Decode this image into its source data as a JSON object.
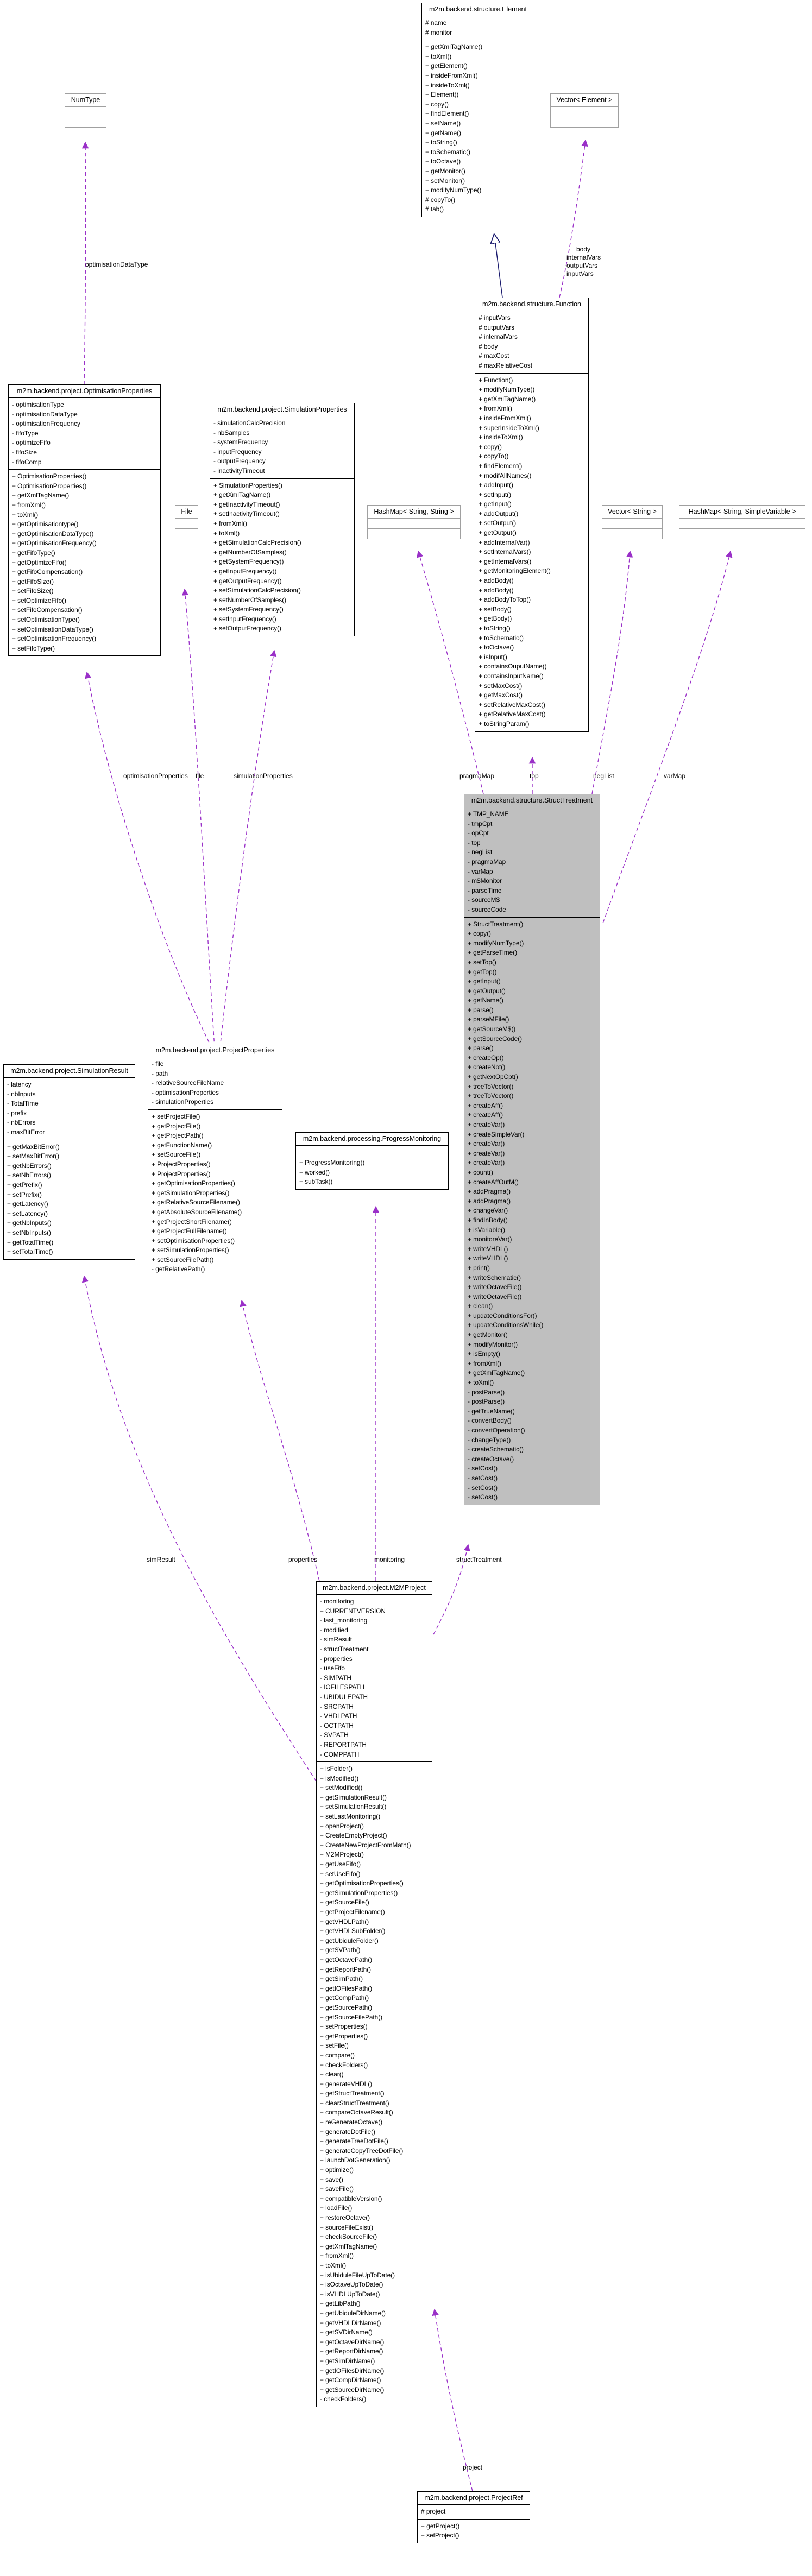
{
  "classes": {
    "element": {
      "name": "m2m.backend.structure.Element",
      "attributes": [
        "# name",
        "# monitor"
      ],
      "operations": [
        "+ getXmlTagName()",
        "+ toXml()",
        "+ getElement()",
        "+ insideFromXml()",
        "+ insideToXml()",
        "+ Element()",
        "+ copy()",
        "+ findElement()",
        "+ setName()",
        "+ getName()",
        "+ toString()",
        "+ toSchematic()",
        "+ toOctave()",
        "+ getMonitor()",
        "+ setMonitor()",
        "+ modifyNumType()",
        "# copyTo()",
        "# tab()"
      ]
    },
    "numtype": {
      "name": "NumType",
      "attributes": [],
      "operations": []
    },
    "vector_element": {
      "name": "Vector< Element >",
      "attributes": [],
      "operations": []
    },
    "function": {
      "name": "m2m.backend.structure.Function",
      "attributes": [
        "# inputVars",
        "# outputVars",
        "# internalVars",
        "# body",
        "# maxCost",
        "# maxRelativeCost"
      ],
      "operations": [
        "+ Function()",
        "+ modifyNumType()",
        "+ getXmlTagName()",
        "+ fromXml()",
        "+ insideFromXml()",
        "+ superInsideToXml()",
        "+ insideToXml()",
        "+ copy()",
        "+ copyTo()",
        "+ findElement()",
        "+ modifAllNames()",
        "+ addInput()",
        "+ setInput()",
        "+ getInput()",
        "+ addOutput()",
        "+ setOutput()",
        "+ getOutput()",
        "+ addInternalVar()",
        "+ setInternalVars()",
        "+ getInternalVars()",
        "+ getMonitoringElement()",
        "+ addBody()",
        "+ addBody()",
        "+ addBodyToTop()",
        "+ setBody()",
        "+ getBody()",
        "+ toString()",
        "+ toSchematic()",
        "+ toOctave()",
        "+ isInput()",
        "+ containsOuputName()",
        "+ containsInputName()",
        "+ setMaxCost()",
        "+ getMaxCost()",
        "+ setRelativeMaxCost()",
        "+ getRelativeMaxCost()",
        "+ toStringParam()"
      ]
    },
    "optimisation": {
      "name": "m2m.backend.project.OptimisationProperties",
      "attributes": [
        "- optimisationType",
        "- optimisationDataType",
        "- optimisationFrequency",
        "- fifoType",
        "- optimizeFifo",
        "- fifoSize",
        "- fifoComp"
      ],
      "operations": [
        "+ OptimisationProperties()",
        "+ OptimisationProperties()",
        "+ getXmlTagName()",
        "+ fromXml()",
        "+ toXml()",
        "+ getOptimisationtype()",
        "+ getOptimisationDataType()",
        "+ getOptimisationFrequency()",
        "+ getFifoType()",
        "+ getOptimizeFifo()",
        "+ getFifoCompensation()",
        "+ getFifoSize()",
        "+ setFifoSize()",
        "+ setOptimizeFifo()",
        "+ setFifoCompensation()",
        "+ setOptimisationType()",
        "+ setOptimisationDataType()",
        "+ setOptimisationFrequency()",
        "+ setFifoType()"
      ]
    },
    "simulation": {
      "name": "m2m.backend.project.SimulationProperties",
      "attributes": [
        "- simulationCalcPrecision",
        "- nbSamples",
        "- systemFrequency",
        "- inputFrequency",
        "- outputFrequency",
        "- inactivityTimeout"
      ],
      "operations": [
        "+ SimulationProperties()",
        "+ getXmlTagName()",
        "+ getInactivityTimeout()",
        "+ setInactivityTimeout()",
        "+ fromXml()",
        "+ toXml()",
        "+ getSimulationCalcPrecision()",
        "+ getNumberOfSamples()",
        "+ getSystemFrequency()",
        "+ getInputFrequency()",
        "+ getOutputFrequency()",
        "+ setSimulationCalcPrecision()",
        "+ setNumberOfSamples()",
        "+ setSystemFrequency()",
        "+ setInputFrequency()",
        "+ setOutputFrequency()"
      ]
    },
    "file": {
      "name": "File",
      "attributes": [],
      "operations": []
    },
    "hashmap_string": {
      "name": "HashMap< String, String >",
      "attributes": [],
      "operations": []
    },
    "vector_string": {
      "name": "Vector< String >",
      "attributes": [],
      "operations": []
    },
    "hashmap_var": {
      "name": "HashMap< String, SimpleVariable >",
      "attributes": [],
      "operations": []
    },
    "struct": {
      "name": "m2m.backend.structure.StructTreatment",
      "attributes": [
        "+ TMP_NAME",
        "- tmpCpt",
        "- opCpt",
        "- top",
        "- negList",
        "- pragmaMap",
        "- varMap",
        "- m$Monitor",
        "- parseTime",
        "- sourceM$",
        "- sourceCode"
      ],
      "operations": [
        "+ StructTreatment()",
        "+ copy()",
        "+ modifyNumType()",
        "+ getParseTime()",
        "+ setTop()",
        "+ getTop()",
        "+ getInput()",
        "+ getOutput()",
        "+ getName()",
        "+ parse()",
        "+ parseMFile()",
        "+ getSourceM$()",
        "+ getSourceCode()",
        "+ parse()",
        "+ createOp()",
        "+ createNot()",
        "+ getNextOpCpt()",
        "+ treeToVector()",
        "+ treeToVector()",
        "+ createAff()",
        "+ createAff()",
        "+ createVar()",
        "+ createSimpleVar()",
        "+ createVar()",
        "+ createVar()",
        "+ createVar()",
        "+ count()",
        "+ createAffOutM()",
        "+ addPragma()",
        "+ addPragma()",
        "+ changeVar()",
        "+ findInBody()",
        "+ isVariable()",
        "+ monitoreVar()",
        "+ writeVHDL()",
        "+ writeVHDL()",
        "+ print()",
        "+ writeSchematic()",
        "+ writeOctaveFile()",
        "+ writeOctaveFile()",
        "+ clean()",
        "+ updateConditionsFor()",
        "+ updateConditionsWhile()",
        "+ getMonitor()",
        "+ modifyMonitor()",
        "+ isEmpty()",
        "+ fromXml()",
        "+ getXmlTagName()",
        "+ toXml()",
        "- postParse()",
        "- postParse()",
        "- getTrueName()",
        "- convertBody()",
        "- convertOperation()",
        "- changeType()",
        "- createSchematic()",
        "- createOctave()",
        "- setCost()",
        "- setCost()",
        "- setCost()",
        "- setCost()"
      ]
    },
    "simresult": {
      "name": "m2m.backend.project.SimulationResult",
      "attributes": [
        "- latency",
        "- nbInputs",
        "- TotalTime",
        "- prefix",
        "- nbErrors",
        "- maxBitError"
      ],
      "operations": [
        "+ getMaxBitError()",
        "+ setMaxBitError()",
        "+ getNbErrors()",
        "+ setNbErrors()",
        "+ getPrefix()",
        "+ setPrefix()",
        "+ getLatency()",
        "+ setLatency()",
        "+ getNbInputs()",
        "+ setNbInputs()",
        "+ getTotalTime()",
        "+ setTotalTime()"
      ]
    },
    "projprops": {
      "name": "m2m.backend.project.ProjectProperties",
      "attributes": [
        "- file",
        "- path",
        "- relativeSourceFileName",
        "- optimisationProperties",
        "- simulationProperties"
      ],
      "operations": [
        "+ setProjectFile()",
        "+ getProjectFile()",
        "+ getProjectPath()",
        "+ getFunctionName()",
        "+ setSourceFile()",
        "+ ProjectProperties()",
        "+ ProjectProperties()",
        "+ getOptimisationProperties()",
        "+ getSimulationProperties()",
        "+ getRelativeSourceFilename()",
        "+ getAbsoluteSourceFilename()",
        "+ getProjectShortFilename()",
        "+ getProjectFullFilename()",
        "+ setOptimisationProperties()",
        "+ setSimulationProperties()",
        "+ setSourceFilePath()",
        "- getRelativePath()"
      ]
    },
    "monitoring": {
      "name": "m2m.backend.processing.ProgressMonitoring",
      "attributes": [],
      "operations": [
        "+ ProgressMonitoring()",
        "+ worked()",
        "+ subTask()"
      ]
    },
    "m2m": {
      "name": "m2m.backend.project.M2MProject",
      "attributes": [
        "- monitoring",
        "+ CURRENTVERSION",
        "- last_monitoring",
        "- modified",
        "- simResult",
        "- structTreatment",
        "- properties",
        "- useFifo",
        "- SIMPATH",
        "- IOFILESPATH",
        "- UBIDULEPATH",
        "- SRCPATH",
        "- VHDLPATH",
        "- OCTPATH",
        "- SVPATH",
        "- REPORTPATH",
        "- COMPPATH"
      ],
      "operations": [
        "+ isFolder()",
        "+ isModified()",
        "+ setModified()",
        "+ getSimulationResult()",
        "+ setSimulationResult()",
        "+ setLastMonitoring()",
        "+ openProject()",
        "+ CreateEmptyProject()",
        "+ CreateNewProjectFromMath()",
        "+ M2MProject()",
        "+ getUseFifo()",
        "+ setUseFifo()",
        "+ getOptimisationProperties()",
        "+ getSimulationProperties()",
        "+ getSourceFile()",
        "+ getProjectFilename()",
        "+ getVHDLPath()",
        "+ getVHDLSubFolder()",
        "+ getUbiduleFolder()",
        "+ getSVPath()",
        "+ getOctavePath()",
        "+ getReportPath()",
        "+ getSimPath()",
        "+ getIOFilesPath()",
        "+ getCompPath()",
        "+ getSourcePath()",
        "+ getSourceFilePath()",
        "+ setProperties()",
        "+ getProperties()",
        "+ setFile()",
        "+ compare()",
        "+ checkFolders()",
        "+ clear()",
        "+ generateVHDL()",
        "+ getStructTreatment()",
        "+ clearStructTreatment()",
        "+ compareOctaveResult()",
        "+ reGenerateOctave()",
        "+ generateDotFile()",
        "+ generateTreeDotFile()",
        "+ generateCopyTreeDotFile()",
        "+ launchDotGeneration()",
        "+ optimize()",
        "+ save()",
        "+ saveFile()",
        "+ compatibleVersion()",
        "+ loadFile()",
        "+ restoreOctave()",
        "+ sourceFileExist()",
        "+ checkSourceFile()",
        "+ getXmlTagName()",
        "+ fromXml()",
        "+ toXml()",
        "+ isUbiduleFileUpToDate()",
        "+ isOctaveUpToDate()",
        "+ isVHDLUpToDate()",
        "+ getLibPath()",
        "+ getUbiduleDirName()",
        "+ getVHDLDirName()",
        "+ getSVDirName()",
        "+ getOctaveDirName()",
        "+ getReportDirName()",
        "+ getSimDirName()",
        "+ getIOFilesDirName()",
        "+ getCompDirName()",
        "+ getSourceDirName()",
        "- checkFolders()"
      ]
    },
    "projref": {
      "name": "m2m.backend.project.ProjectRef",
      "attributes": [
        "# project"
      ],
      "operations": [
        "+ getProject()",
        "+ setProject()"
      ]
    }
  },
  "edge_labels": {
    "optimisationDataType": "optimisationDataType",
    "function_vars": [
      "body",
      "internalVars",
      "outputVars",
      "inputVars"
    ],
    "pragmaMap": "pragmaMap",
    "top": "top",
    "negList": "negList",
    "varMap": "varMap",
    "optimisationProperties": "optimisationProperties",
    "file": "file",
    "simulationProperties": "simulationProperties",
    "simResult": "simResult",
    "properties": "properties",
    "monitoring": "monitoring",
    "structTreatment": "structTreatment",
    "project": "project"
  },
  "colors": {
    "dependency": "#9a30c8",
    "inheritance": "#1a1a6e",
    "highlight_fill": "#bfbfbf",
    "border": "#000000",
    "template_border": "#a0a0a0"
  }
}
